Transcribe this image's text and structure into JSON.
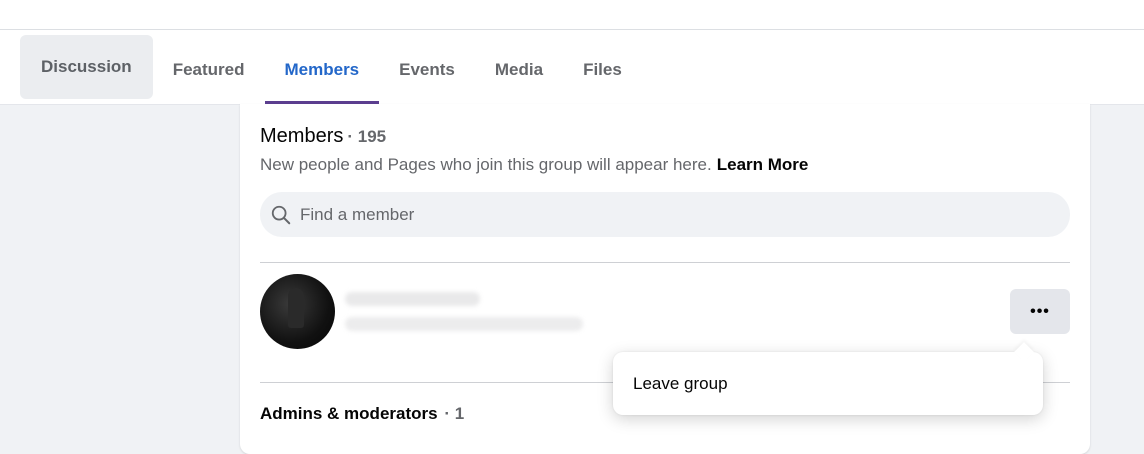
{
  "tabs": [
    {
      "label": "Discussion"
    },
    {
      "label": "Featured"
    },
    {
      "label": "Members"
    },
    {
      "label": "Events"
    },
    {
      "label": "Media"
    },
    {
      "label": "Files"
    }
  ],
  "active_tab": "Members",
  "members": {
    "title": "Members",
    "count": "· 195",
    "subtitle": "New people and Pages who join this group will appear here.",
    "learn_more": "Learn More",
    "search_placeholder": "Find a member"
  },
  "member_row": {
    "more_label": "•••"
  },
  "admins": {
    "title": "Admins & moderators",
    "count": "· 1"
  },
  "menu": {
    "items": [
      {
        "label": "Leave group"
      }
    ]
  },
  "colors": {
    "accent": "#2367c9",
    "tab_underline": "#5b3e8f",
    "background": "#f0f2f5"
  },
  "icons": {
    "search": "search-icon",
    "more": "more-options-icon"
  }
}
